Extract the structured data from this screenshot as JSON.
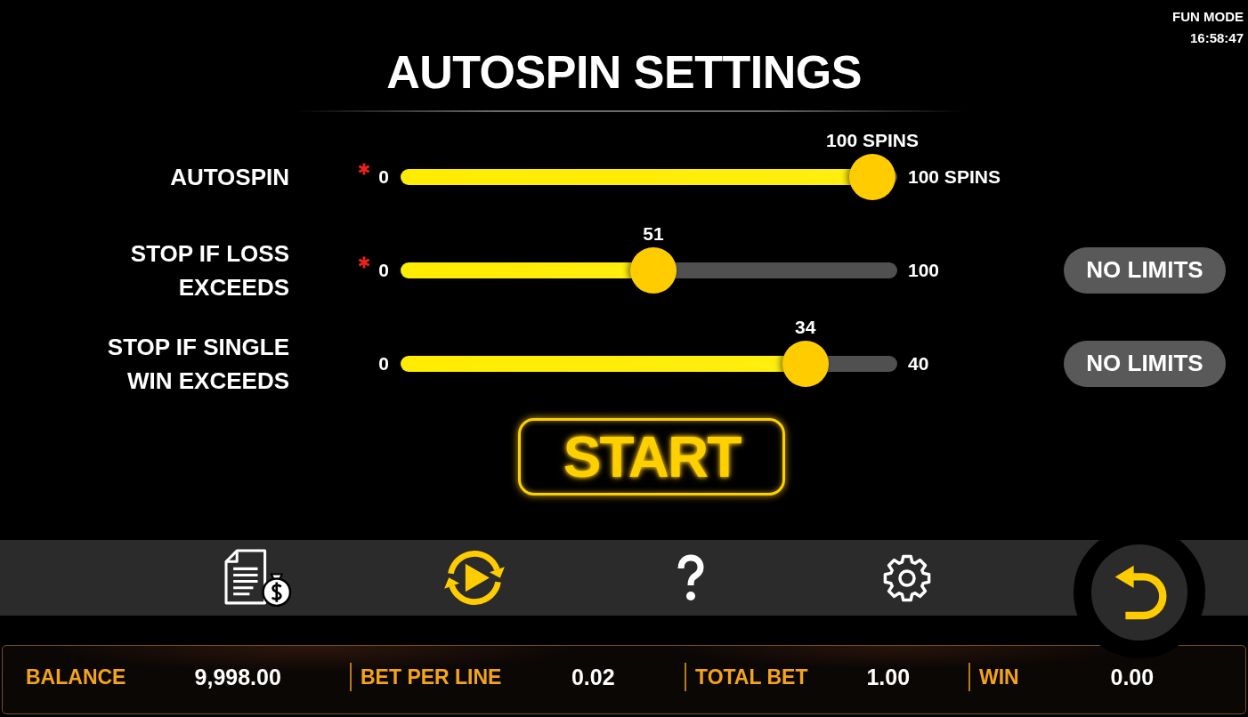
{
  "status": {
    "mode": "FUN MODE",
    "time": "16:58:47"
  },
  "title": "AUTOSPIN SETTINGS",
  "sliders": [
    {
      "label": "AUTOSPIN",
      "required": true,
      "min": "0",
      "max": "100 SPINS",
      "value": "100 SPINS",
      "level": 1
    },
    {
      "label": "STOP IF LOSS EXCEEDS",
      "required": true,
      "min": "0",
      "max": "100",
      "value": "51",
      "level": 0.51,
      "button": "NO LIMITS"
    },
    {
      "label": "STOP IF SINGLE WIN EXCEEDS",
      "required": false,
      "min": "0",
      "max": "40",
      "value": "34",
      "level": 0.85,
      "button": "NO LIMITS"
    }
  ],
  "start_button": "START",
  "toolbar": [
    {
      "kind": "paytable",
      "selected": false
    },
    {
      "kind": "autoplay",
      "selected": true
    },
    {
      "kind": "help",
      "selected": false
    },
    {
      "kind": "settings",
      "selected": false
    }
  ],
  "info_bar": [
    {
      "label": "BALANCE",
      "value": "9,998.00"
    },
    {
      "label": "BET PER LINE",
      "value": "0.02"
    },
    {
      "label": "TOTAL BET",
      "value": "1.00"
    },
    {
      "label": "WIN",
      "value": "0.00"
    }
  ]
}
